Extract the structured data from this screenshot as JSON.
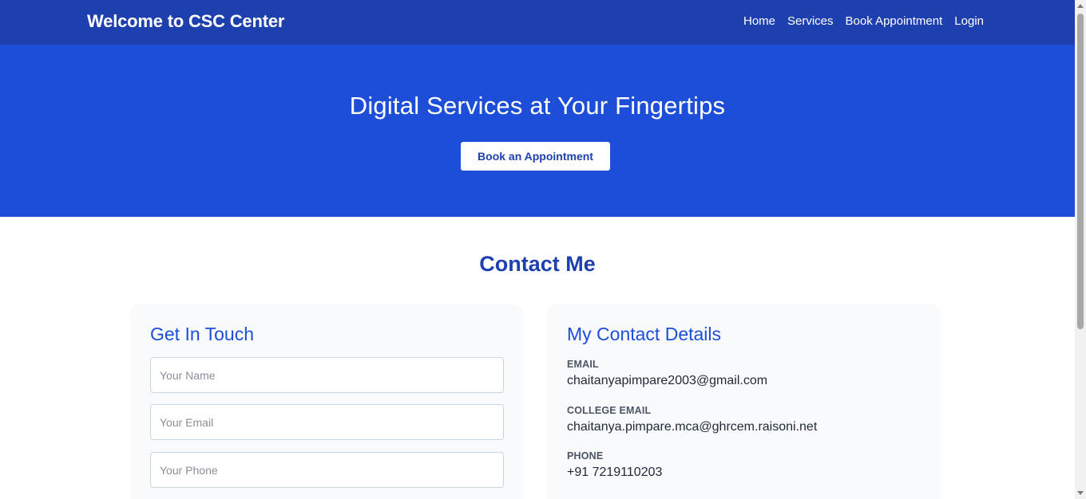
{
  "navbar": {
    "brand": "Welcome to CSC Center",
    "links": [
      "Home",
      "Services",
      "Book Appointment",
      "Login"
    ]
  },
  "hero": {
    "title": "Digital Services at Your Fingertips",
    "button_label": "Book an Appointment"
  },
  "contact": {
    "title": "Contact Me",
    "form": {
      "title": "Get In Touch",
      "name_placeholder": "Your Name",
      "email_placeholder": "Your Email",
      "phone_placeholder": "Your Phone"
    },
    "details": {
      "title": "My Contact Details",
      "items": [
        {
          "label": "EMAIL",
          "value": "chaitanyapimpare2003@gmail.com"
        },
        {
          "label": "COLLEGE EMAIL",
          "value": "chaitanya.pimpare.mca@ghrcem.raisoni.net"
        },
        {
          "label": "PHONE",
          "value": "+91 7219110203"
        }
      ]
    }
  },
  "colors": {
    "navbar": "#1e40af",
    "hero": "#1d4ed8",
    "accent": "#1d4ed8",
    "card": "#f8fafc"
  }
}
